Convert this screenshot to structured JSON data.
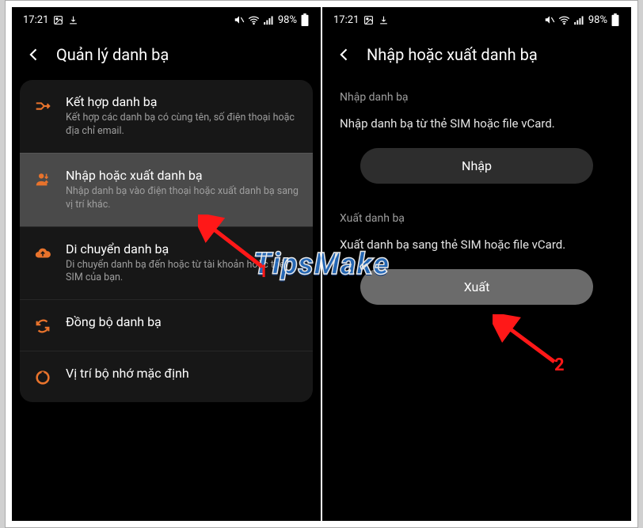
{
  "status": {
    "time": "17:21",
    "battery_pct": "98%"
  },
  "left": {
    "title": "Quản lý danh bạ",
    "items": [
      {
        "title": "Kết hợp danh bạ",
        "desc": "Kết hợp các danh bạ có cùng tên, số điện thoại hoặc địa chỉ email."
      },
      {
        "title": "Nhập hoặc xuất danh bạ",
        "desc": "Nhập danh bạ vào điện thoại hoặc xuất danh bạ sang vị trí khác."
      },
      {
        "title": "Di chuyển danh bạ",
        "desc": "Di chuyển danh bạ đến hoặc từ tài khoản hoặc thẻ SIM của bạn."
      },
      {
        "title": "Đồng bộ danh bạ",
        "desc": ""
      },
      {
        "title": "Vị trí bộ nhớ mặc định",
        "desc": ""
      }
    ]
  },
  "right": {
    "title": "Nhập hoặc xuất danh bạ",
    "import_section_label": "Nhập danh bạ",
    "import_desc": "Nhập danh bạ từ thẻ SIM hoặc file vCard.",
    "import_btn": "Nhập",
    "export_section_label": "Xuất danh bạ",
    "export_desc": "Xuất danh bạ sang thẻ SIM hoặc file vCard.",
    "export_btn": "Xuất"
  },
  "annotations": {
    "label1": "1",
    "label2": "2"
  },
  "watermark": "TipsMake"
}
